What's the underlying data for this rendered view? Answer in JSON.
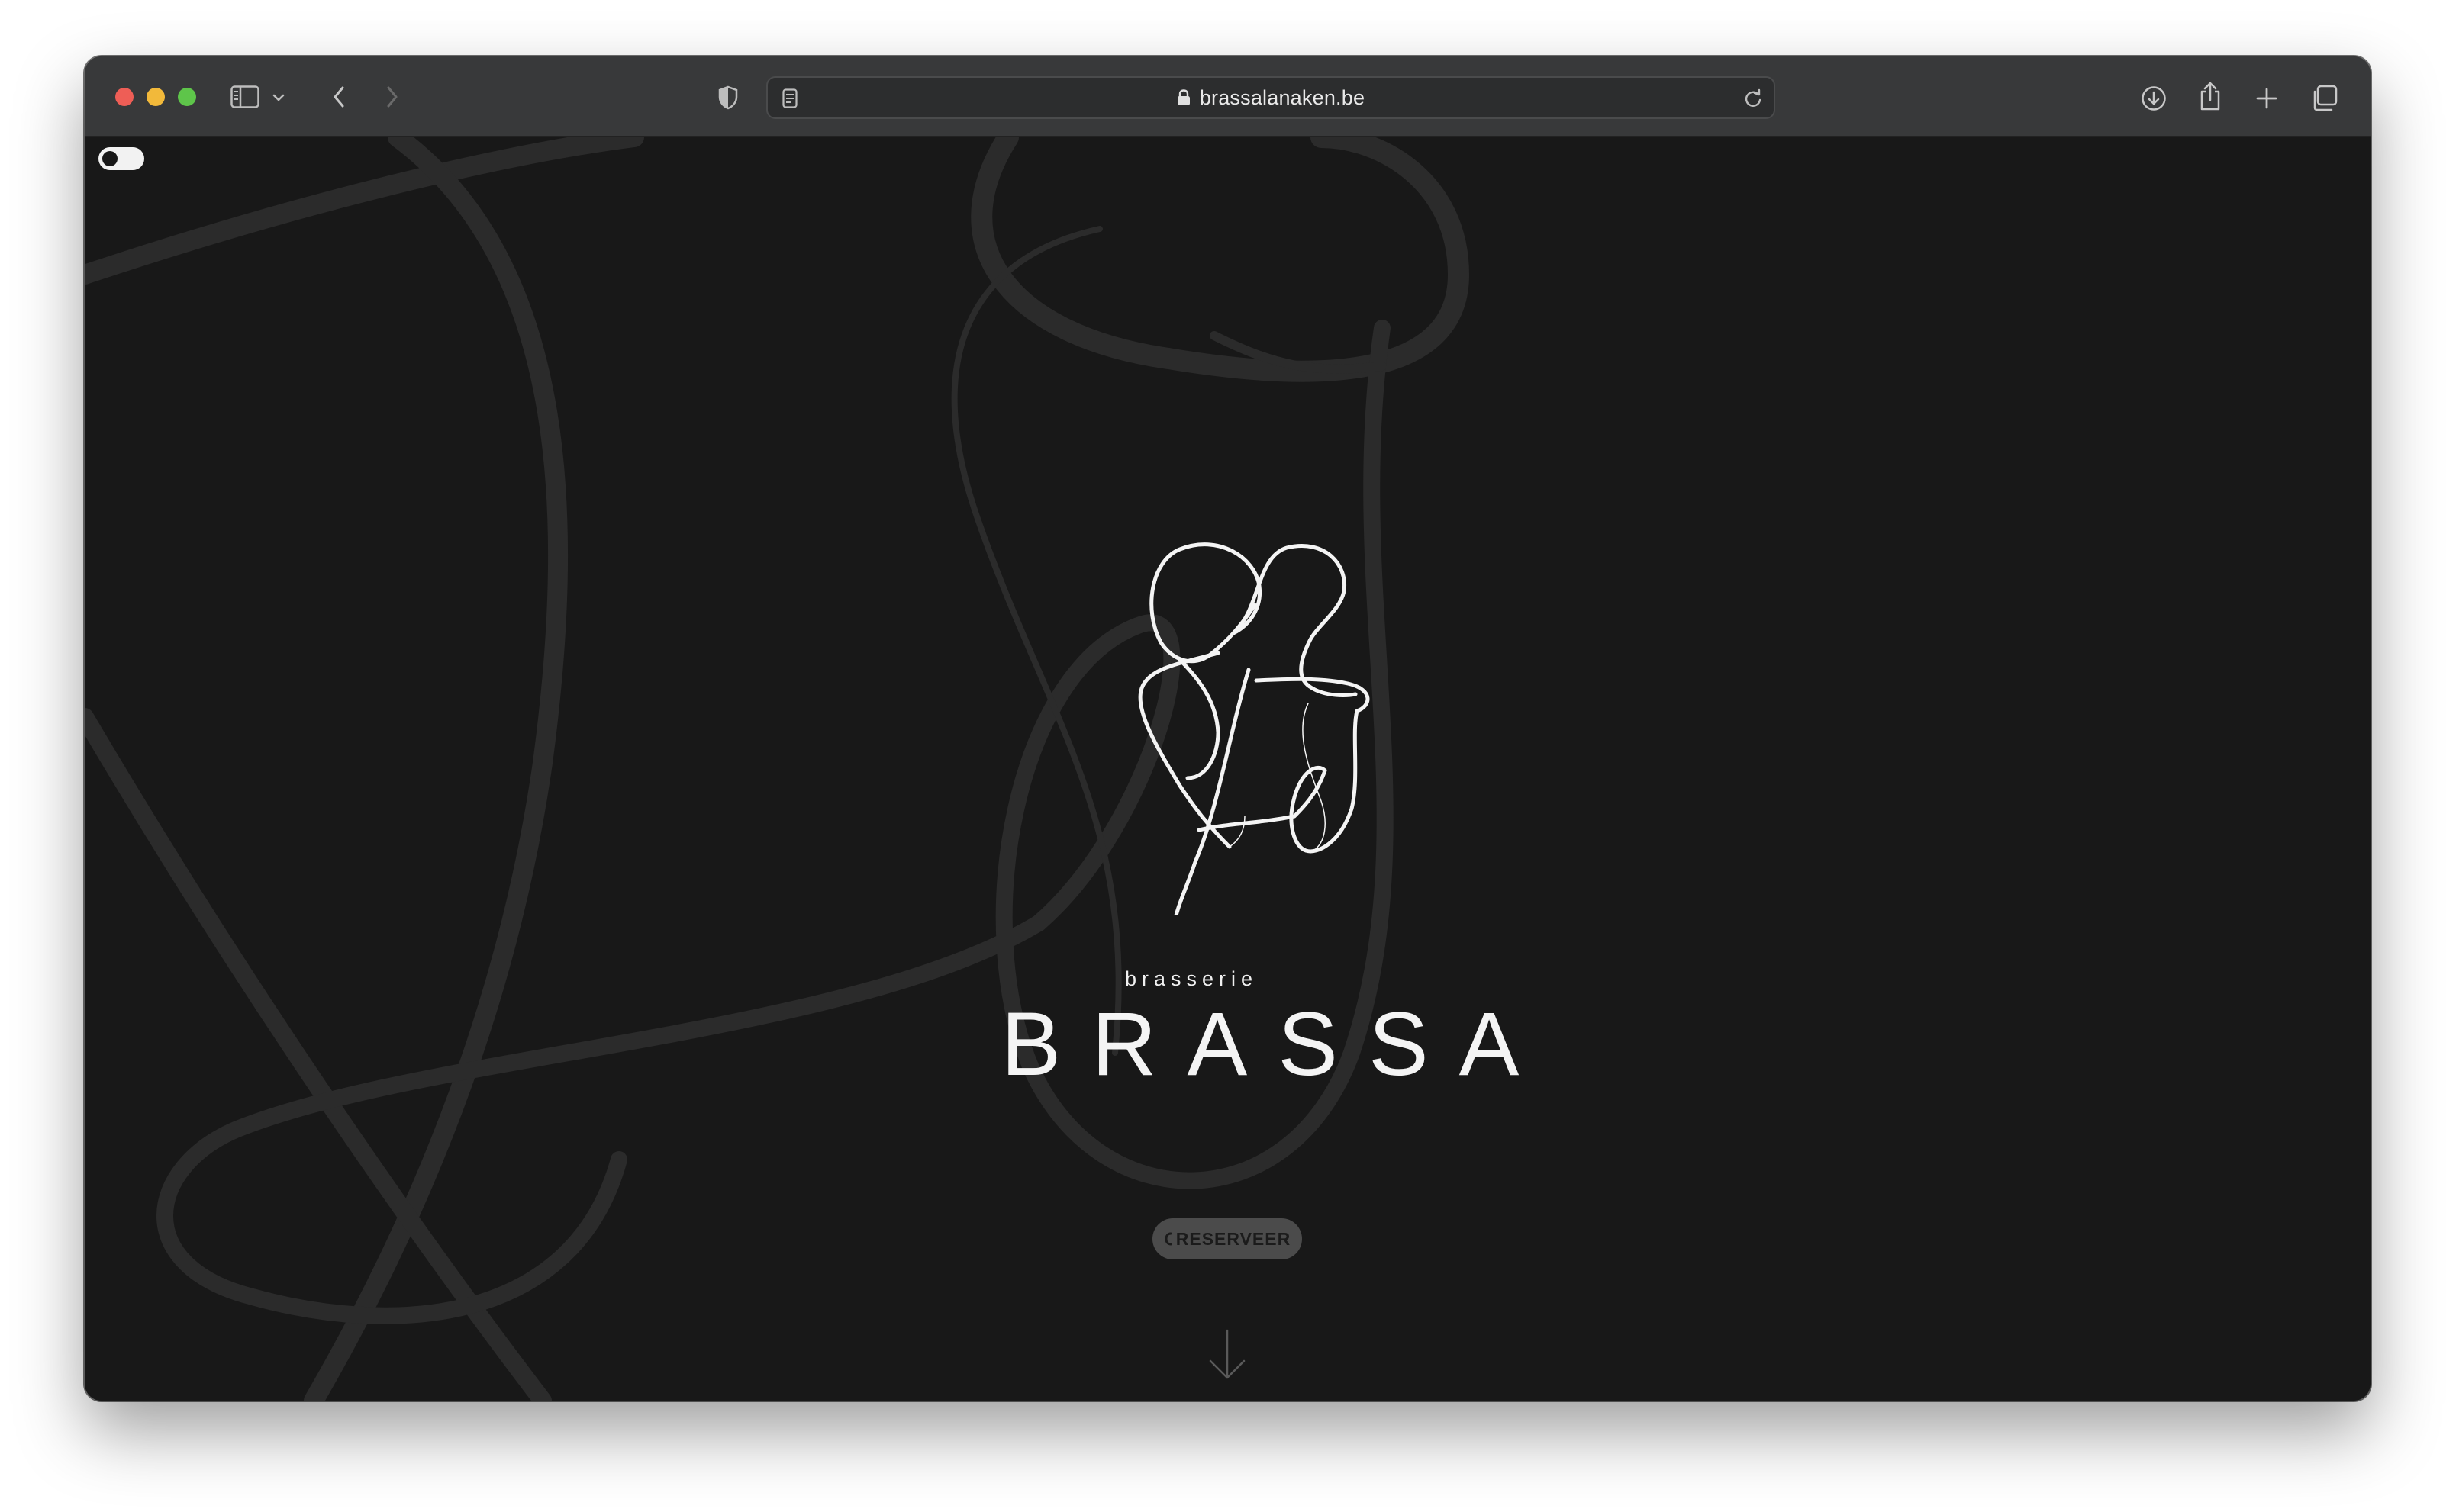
{
  "browser": {
    "url": "brassalanaken.be"
  },
  "hero": {
    "subtitle": "brasserie",
    "title": "BRASSA",
    "reserve_label": "RESERVEER"
  },
  "colors": {
    "background": "#181818",
    "toolbar": "#38393a",
    "button": "#4b4b4b",
    "text": "#f4f4f4"
  },
  "icons": {
    "toolbar": [
      "sidebar-icon",
      "chevron-down-icon",
      "back-icon",
      "forward-icon",
      "shield-icon",
      "reader-icon",
      "lock-icon",
      "reload-icon",
      "download-icon",
      "share-icon",
      "plus-icon",
      "tabs-icon"
    ],
    "page": [
      "theme-toggle",
      "phone-icon",
      "arrow-down-icon"
    ]
  }
}
